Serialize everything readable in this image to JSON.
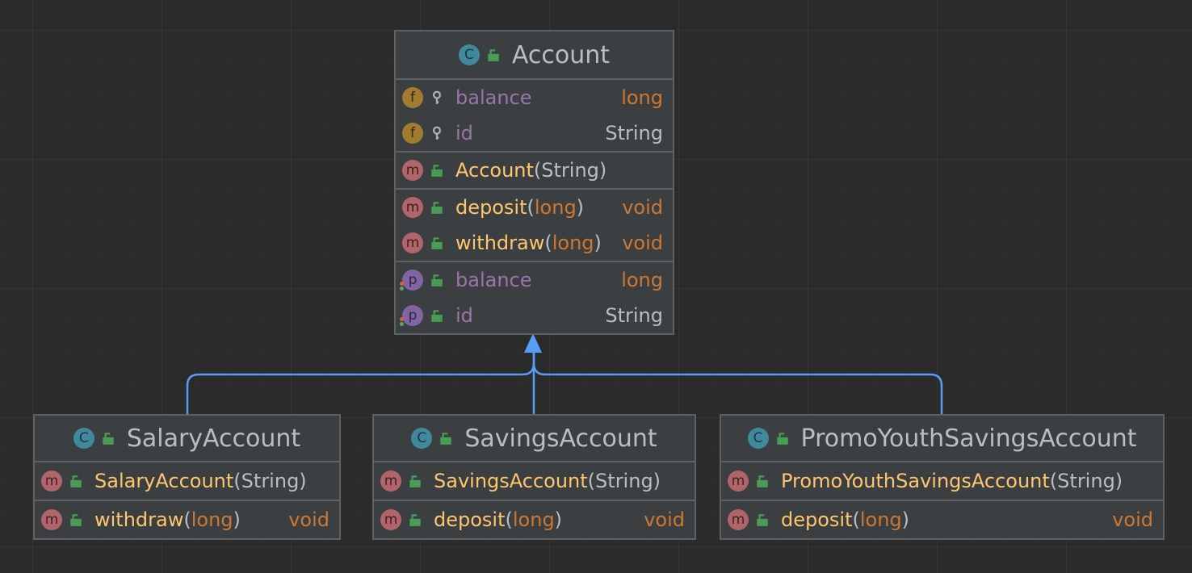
{
  "colors": {
    "edge": "#589df6",
    "field_name": "#9876aa",
    "method_name": "#ffc66d",
    "keyword_type": "#cc7832",
    "plain_text": "#bbbdc0"
  },
  "badges": {
    "class": "C",
    "field": "f",
    "method": "m",
    "property": "p"
  },
  "classes": {
    "account": {
      "name": "Account",
      "fields": [
        {
          "name": "balance",
          "type": "long"
        },
        {
          "name": "id",
          "type": "String"
        }
      ],
      "constructors": [
        {
          "name": "Account",
          "open": "(",
          "param": "String",
          "close": ")"
        }
      ],
      "methods": [
        {
          "name": "deposit",
          "open": "(",
          "param": "long",
          "close": ")",
          "returns": "void"
        },
        {
          "name": "withdraw",
          "open": "(",
          "param": "long",
          "close": ")",
          "returns": "void"
        }
      ],
      "properties": [
        {
          "name": "balance",
          "type": "long"
        },
        {
          "name": "id",
          "type": "String"
        }
      ]
    },
    "salary": {
      "name": "SalaryAccount",
      "constructor": {
        "name": "SalaryAccount",
        "open": "(",
        "param": "String",
        "close": ")"
      },
      "method": {
        "name": "withdraw",
        "open": "(",
        "param": "long",
        "close": ")",
        "returns": "void"
      }
    },
    "savings": {
      "name": "SavingsAccount",
      "constructor": {
        "name": "SavingsAccount",
        "open": "(",
        "param": "String",
        "close": ")"
      },
      "method": {
        "name": "deposit",
        "open": "(",
        "param": "long",
        "close": ")",
        "returns": "void"
      }
    },
    "promo": {
      "name": "PromoYouthSavingsAccount",
      "constructor": {
        "name": "PromoYouthSavingsAccount",
        "open": "(",
        "param": "String",
        "close": ")"
      },
      "method": {
        "name": "deposit",
        "open": "(",
        "param": "long",
        "close": ")",
        "returns": "void"
      }
    }
  }
}
